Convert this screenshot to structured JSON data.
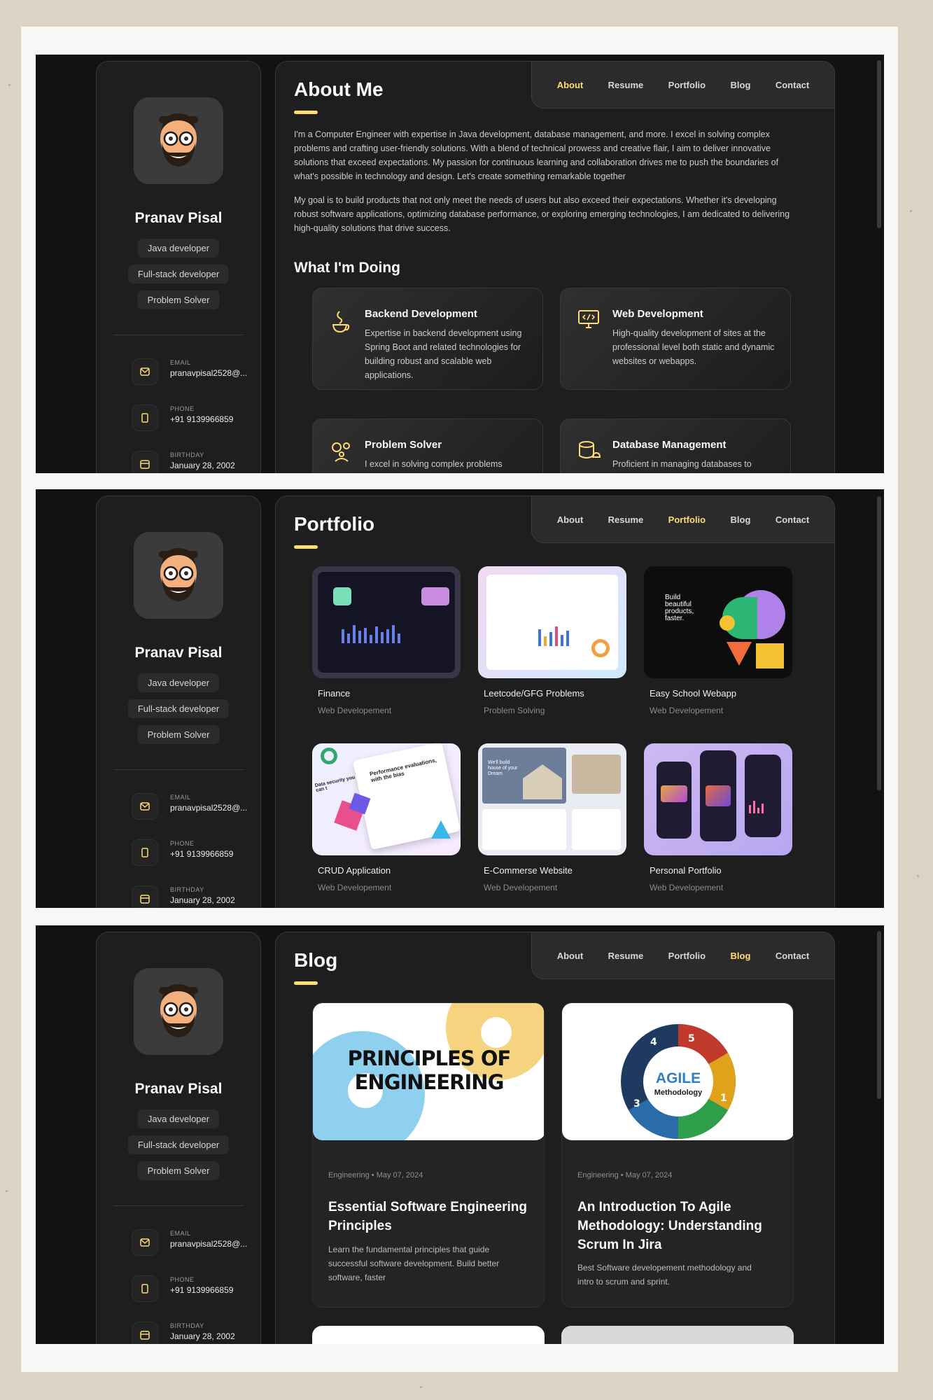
{
  "profile": {
    "name": "Pranav Pisal",
    "tags": [
      "Java developer",
      "Full-stack developer",
      "Problem Solver"
    ],
    "email_label": "EMAIL",
    "email": "pranavpisal2528@...",
    "phone_label": "PHONE",
    "phone": "+91 9139966859",
    "birthday_label": "BIRTHDAY",
    "birthday": "January 28, 2002"
  },
  "nav": [
    "About",
    "Resume",
    "Portfolio",
    "Blog",
    "Contact"
  ],
  "about": {
    "title": "About Me",
    "p1": "I'm a Computer Engineer with expertise in Java development, database management, and more. I excel in solving complex problems and crafting user-friendly solutions. With a blend of technical prowess and creative flair, I aim to deliver innovative solutions that exceed expectations. My passion for continuous learning and collaboration drives me to push the boundaries of what's possible in technology and design. Let's create something remarkable together",
    "p2": "My goal is to build products that not only meet the needs of users but also exceed their expectations. Whether it's developing robust software applications, optimizing database performance, or exploring emerging technologies, I am dedicated to delivering high-quality solutions that drive success.",
    "doing_title": "What I'm Doing",
    "services": [
      {
        "title": "Backend Development",
        "desc": "Expertise in backend development using Spring Boot and related technologies for building robust and scalable web applications.",
        "icon": "java-icon"
      },
      {
        "title": "Web Development",
        "desc": "High-quality development of sites at the professional level both static and dynamic websites or webapps.",
        "icon": "code-monitor-icon"
      },
      {
        "title": "Problem Solver",
        "desc": "I excel in solving complex problems",
        "icon": "gears-person-icon"
      },
      {
        "title": "Database Management",
        "desc": "Proficient in managing databases to",
        "icon": "database-icon"
      }
    ]
  },
  "portfolio": {
    "title": "Portfolio",
    "items": [
      {
        "title": "Finance",
        "category": "Web Developement"
      },
      {
        "title": "Leetcode/GFG Problems",
        "category": "Problem Solving"
      },
      {
        "title": "Easy School Webapp",
        "category": "Web Developement"
      },
      {
        "title": "CRUD Application",
        "category": "Web Developement"
      },
      {
        "title": "E-Commerse Website",
        "category": "Web Developement"
      },
      {
        "title": "Personal Portfolio",
        "category": "Web Developement"
      }
    ],
    "school_text": "Build beautiful products, faster.",
    "crud_text_1": "Performance evaluations, with the bias",
    "crud_text_2": "Data security you can t",
    "house_text": "We'll build house of your Dream"
  },
  "blog": {
    "title": "Blog",
    "posts": [
      {
        "category": "Engineering",
        "date": "May 07, 2024",
        "title": "Essential Software Engineering Principles",
        "desc": "Learn the fundamental principles that guide successful software development. Build better software, faster",
        "img_line1": "PRINCIPLES OF",
        "img_line2": "ENGINEERING"
      },
      {
        "category": "Engineering",
        "date": "May 07, 2024",
        "title": "An Introduction To Agile Methodology: Understanding Scrum In Jira",
        "desc": "Best Software developement methodology and intro to scrum and sprint.",
        "img_line1": "AGILE",
        "img_line2": "Methodology"
      }
    ]
  },
  "colors": {
    "accent": "#ffdb70",
    "panel": "#1e1e1f",
    "background": "#121212"
  }
}
